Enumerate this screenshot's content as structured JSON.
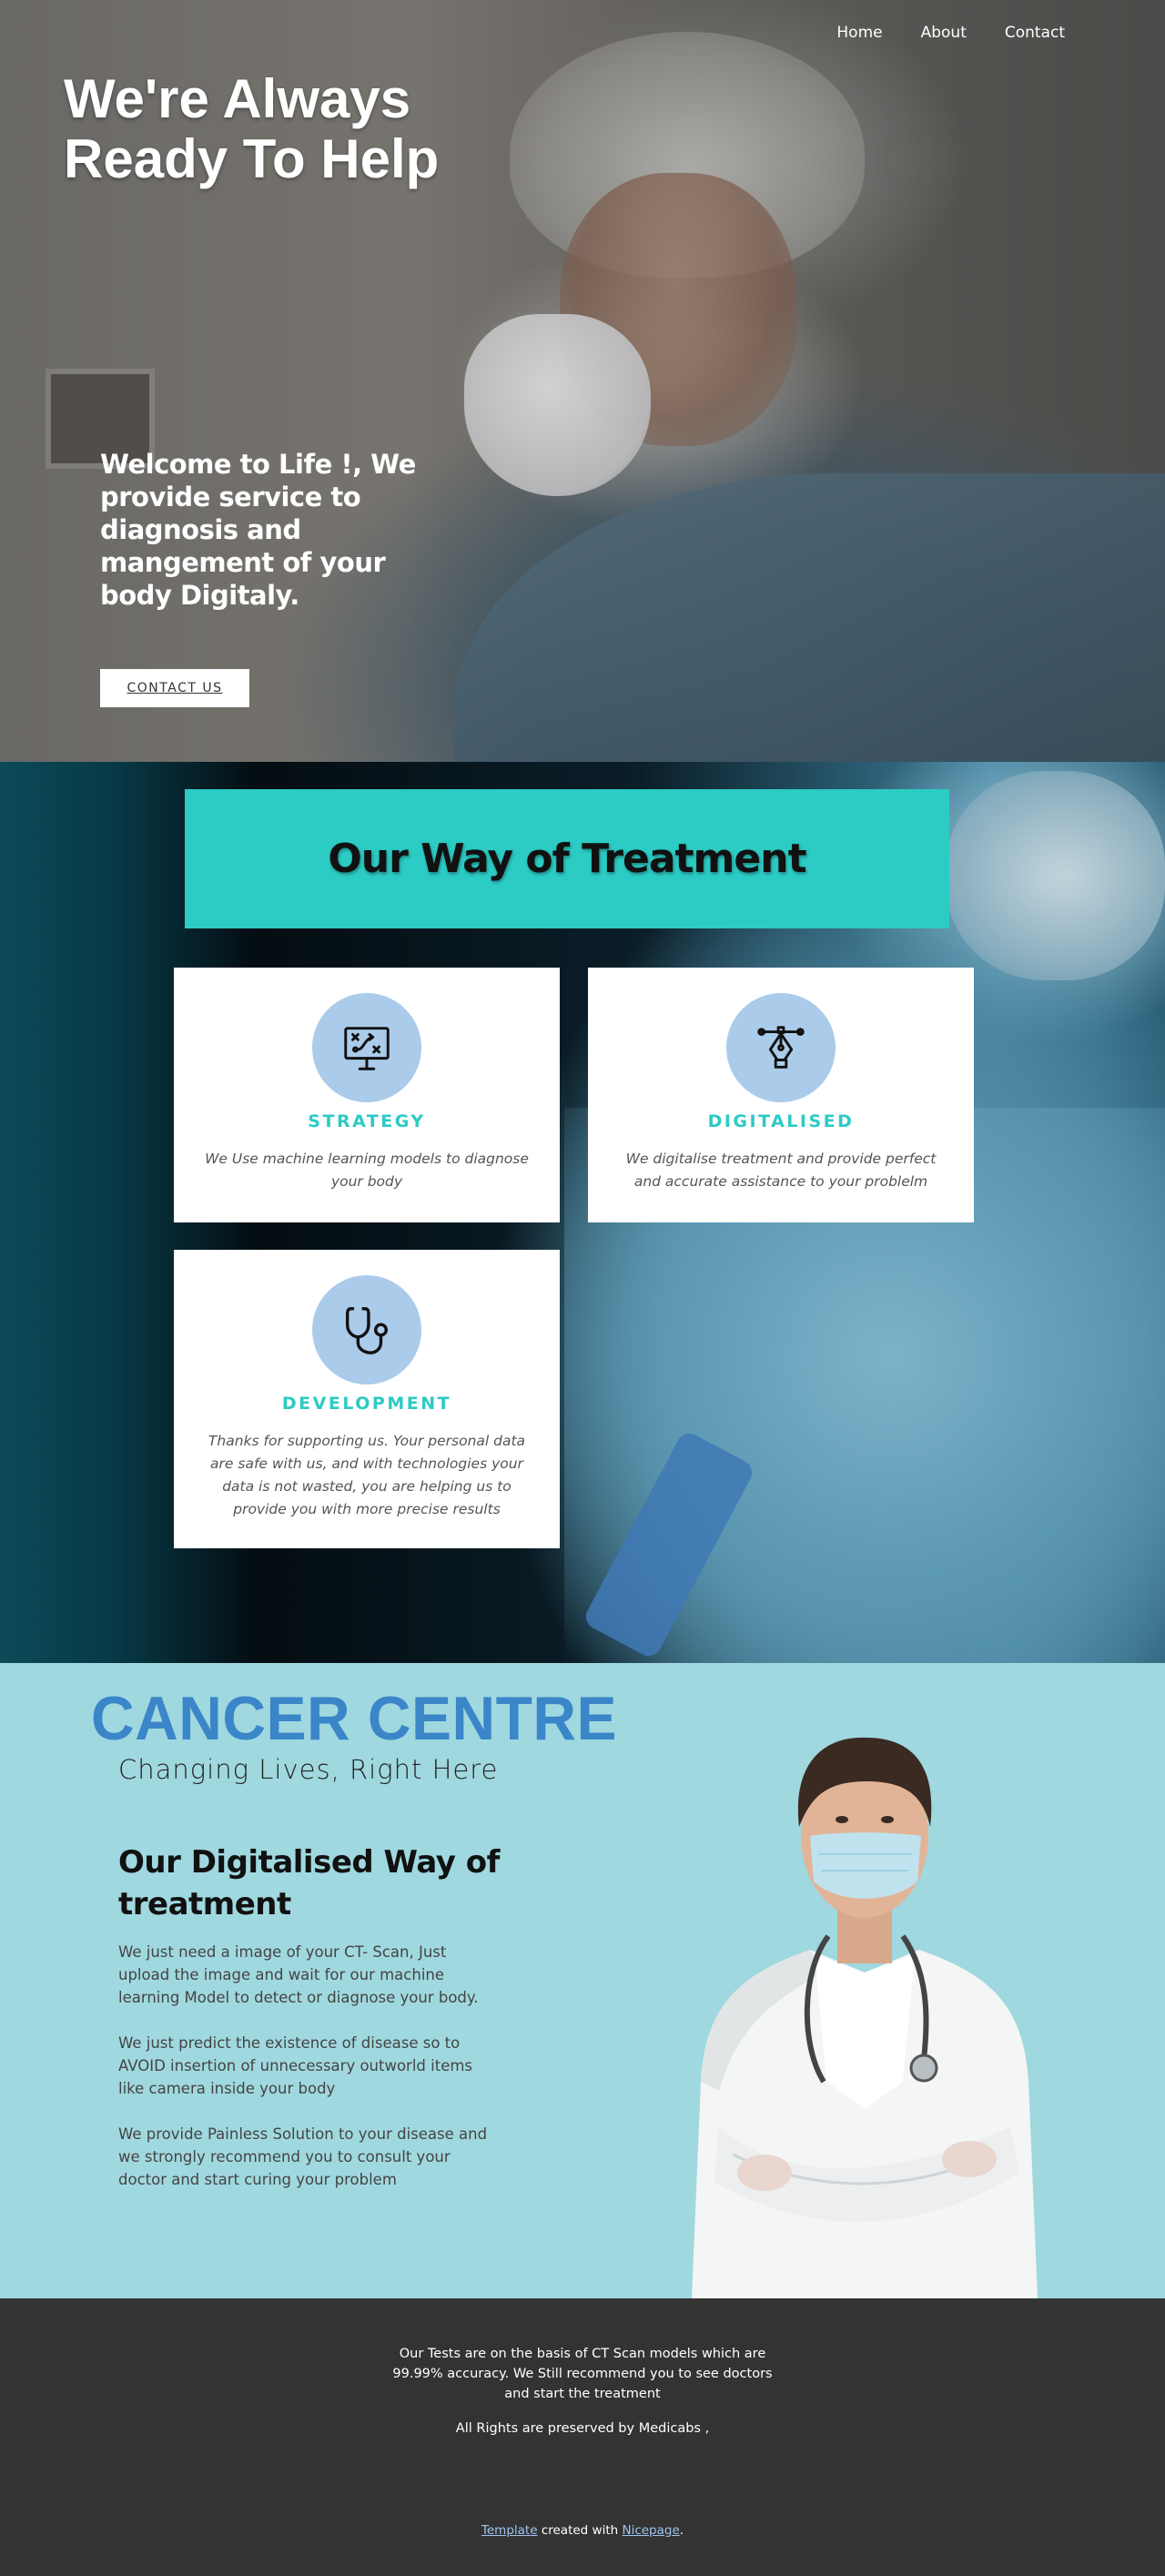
{
  "nav": {
    "items": [
      "Home",
      "About",
      "Contact"
    ]
  },
  "hero": {
    "title_line1": "We're Always",
    "title_line2": "Ready To Help",
    "subtitle": "Welcome to Life !, We provide service to diagnosis and mangement of your body Digitaly.",
    "button": "CONTACT US"
  },
  "treatment": {
    "heading": "Our Way of Treatment",
    "cards": [
      {
        "icon": "presentation-board-icon",
        "title": "STRATEGY",
        "desc": "We Use machine learning models to diagnose your body"
      },
      {
        "icon": "pen-tool-icon",
        "title": "DIGITALISED",
        "desc": "We digitalise treatment and provide perfect and accurate assistance to your problelm"
      },
      {
        "icon": "stethoscope-icon",
        "title": "DEVELOPMENT",
        "desc": "Thanks for supporting us. Your personal data are safe with us, and with technologies your data is not wasted, you are helping us to provide you with more precise results"
      }
    ]
  },
  "cancer": {
    "title": "CANCER CENTRE",
    "tagline": "Changing Lives, Right Here",
    "heading": "Our Digitalised Way of treatment",
    "paragraphs": [
      " We just need a image of your CT- Scan, Just upload the image and wait for our machine learning Model to detect or diagnose your body.",
      "We just predict the existence of disease so to AVOID insertion of unnecessary outworld items like camera inside your body",
      "We provide Painless Solution to your disease and we strongly recommend you to consult your doctor and start curing your problem"
    ]
  },
  "footer": {
    "note": "Our Tests are on the basis of CT Scan models which are 99.99% accuracy. We Still recommend you to see doctors and start the treatment",
    "rights": "All Rights are preserved by Medicabs ,",
    "credit_link1": "Template",
    "credit_mid": " created with ",
    "credit_link2": "Nicepage",
    "credit_end": "."
  },
  "colors": {
    "accent_teal": "#2ccbc4",
    "icon_circle": "#aacbea",
    "cancer_bg": "#a0d8df",
    "cancer_title": "#3b86c9",
    "footer_bg": "#333333"
  }
}
